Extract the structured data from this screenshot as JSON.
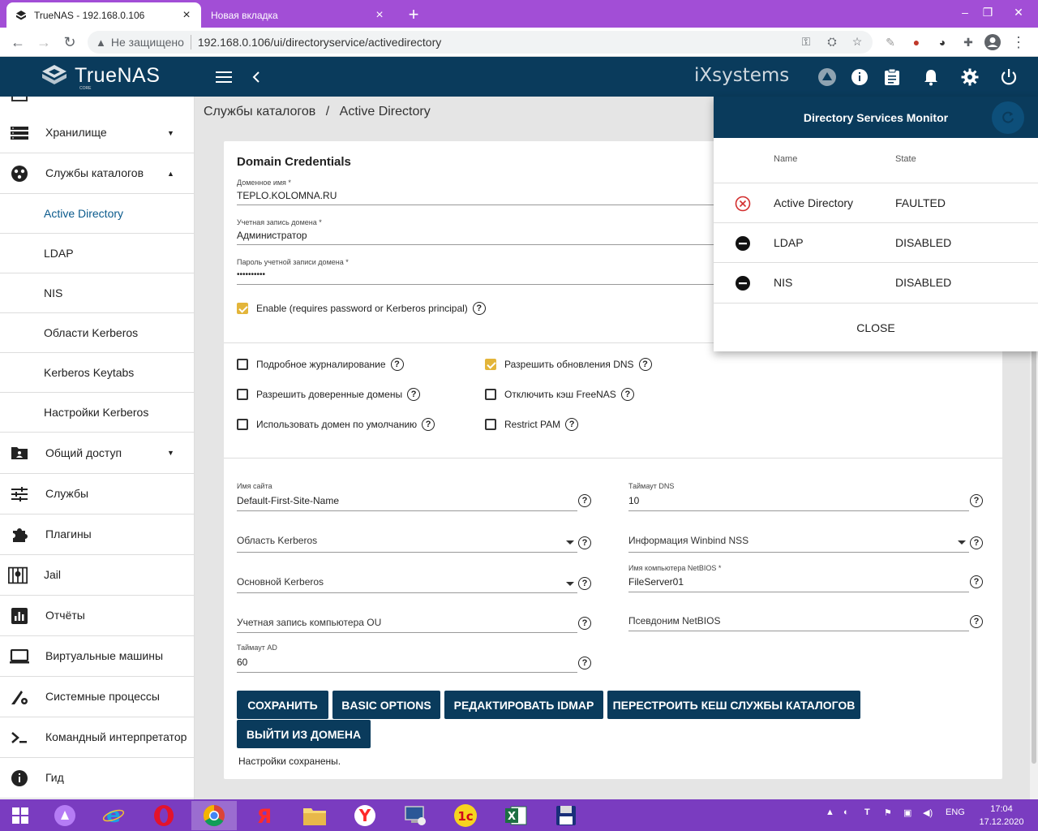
{
  "browser": {
    "tabs": [
      {
        "title": "TrueNAS - 192.168.0.106",
        "active": true
      },
      {
        "title": "Новая вкладка",
        "active": false
      }
    ],
    "security_label": "Не защищено",
    "url": "192.168.0.106/ui/directoryservice/activedirectory"
  },
  "app": {
    "logo_text": "TrueNAS",
    "logo_sub": "CORE",
    "vendor_text": "iXsystems"
  },
  "sidebar": {
    "items": [
      {
        "label": "Хранилище",
        "icon": "storage-icon",
        "expand": "down"
      },
      {
        "label": "Службы каталогов",
        "icon": "directory-services-icon",
        "expand": "up"
      },
      {
        "label": "Общий доступ",
        "icon": "sharing-icon",
        "expand": "down"
      },
      {
        "label": "Службы",
        "icon": "services-icon"
      },
      {
        "label": "Плагины",
        "icon": "plugins-icon"
      },
      {
        "label": "Jail",
        "icon": "jail-icon"
      },
      {
        "label": "Отчёты",
        "icon": "reports-icon"
      },
      {
        "label": "Виртуальные машины",
        "icon": "vm-icon"
      },
      {
        "label": "Системные процессы",
        "icon": "tasks-icon"
      },
      {
        "label": "Командный интерпретатор",
        "icon": "shell-icon"
      },
      {
        "label": "Гид",
        "icon": "guide-icon"
      }
    ],
    "sub_items": [
      "Active Directory",
      "LDAP",
      "NIS",
      "Области Kerberos",
      "Kerberos Keytabs",
      "Настройки Kerberos"
    ]
  },
  "breadcrumb": {
    "parent": "Службы каталогов",
    "separator": "/",
    "current": "Active Directory"
  },
  "form": {
    "section_title": "Domain Credentials",
    "domain_name": {
      "label": "Доменное имя *",
      "value": "TEPLO.KOLOMNA.RU"
    },
    "domain_account": {
      "label": "Учетная запись домена *",
      "value": "Администратор"
    },
    "domain_password": {
      "label": "Пароль учетной записи домена *",
      "value": "••••••••••"
    },
    "enable": {
      "label": "Enable (requires password or Kerberos principal)",
      "checked": true
    },
    "checkboxes": {
      "verbose_logging": {
        "label": "Подробное журналирование",
        "checked": false
      },
      "allow_dns_updates": {
        "label": "Разрешить обновления DNS",
        "checked": true
      },
      "allow_trusted_domains": {
        "label": "Разрешить доверенные домены",
        "checked": false
      },
      "disable_freenas_cache": {
        "label": "Отключить кэш FreeNAS",
        "checked": false
      },
      "use_default_domain": {
        "label": "Использовать домен по умолчанию",
        "checked": false
      },
      "restrict_pam": {
        "label": "Restrict PAM",
        "checked": false
      }
    },
    "site_name": {
      "label": "Имя сайта",
      "value": "Default-First-Site-Name"
    },
    "dns_timeout": {
      "label": "Таймаут DNS",
      "value": "10"
    },
    "kerberos_realm": {
      "placeholder": "Область Kerberos"
    },
    "winbind_nss": {
      "placeholder": "Информация Winbind NSS"
    },
    "kerberos_principal": {
      "placeholder": "Основной Kerberos"
    },
    "netbios_name": {
      "label": "Имя компьютера NetBIOS *",
      "value": "FileServer01"
    },
    "computer_account_ou": {
      "placeholder": "Учетная запись компьютера OU"
    },
    "netbios_alias": {
      "placeholder": "Псевдоним NetBIOS"
    },
    "ad_timeout": {
      "label": "Таймаут AD",
      "value": "60"
    },
    "buttons": {
      "save": "СОХРАНИТЬ",
      "basic_options": "BASIC OPTIONS",
      "edit_idmap": "РЕДАКТИРОВАТЬ IDMAP",
      "rebuild_cache": "ПЕРЕСТРОИТЬ КЕШ СЛУЖБЫ КАТАЛОГОВ",
      "leave_domain": "ВЫЙТИ ИЗ ДОМЕНА"
    },
    "status_message": "Настройки сохранены."
  },
  "monitor": {
    "title": "Directory Services Monitor",
    "col_name": "Name",
    "col_state": "State",
    "rows": [
      {
        "name": "Active Directory",
        "state": "FAULTED",
        "status_icon": "faulted-icon"
      },
      {
        "name": "LDAP",
        "state": "DISABLED",
        "status_icon": "disabled-icon"
      },
      {
        "name": "NIS",
        "state": "DISABLED",
        "status_icon": "disabled-icon"
      }
    ],
    "close_label": "CLOSE"
  },
  "taskbar": {
    "language": "ENG",
    "time": "17:04",
    "date": "17.12.2020"
  },
  "colors": {
    "primary": "#0a3b5c",
    "browser_frame": "#a24ed6",
    "checkbox_on": "#e3b53a",
    "faulted": "#d32f2f"
  }
}
